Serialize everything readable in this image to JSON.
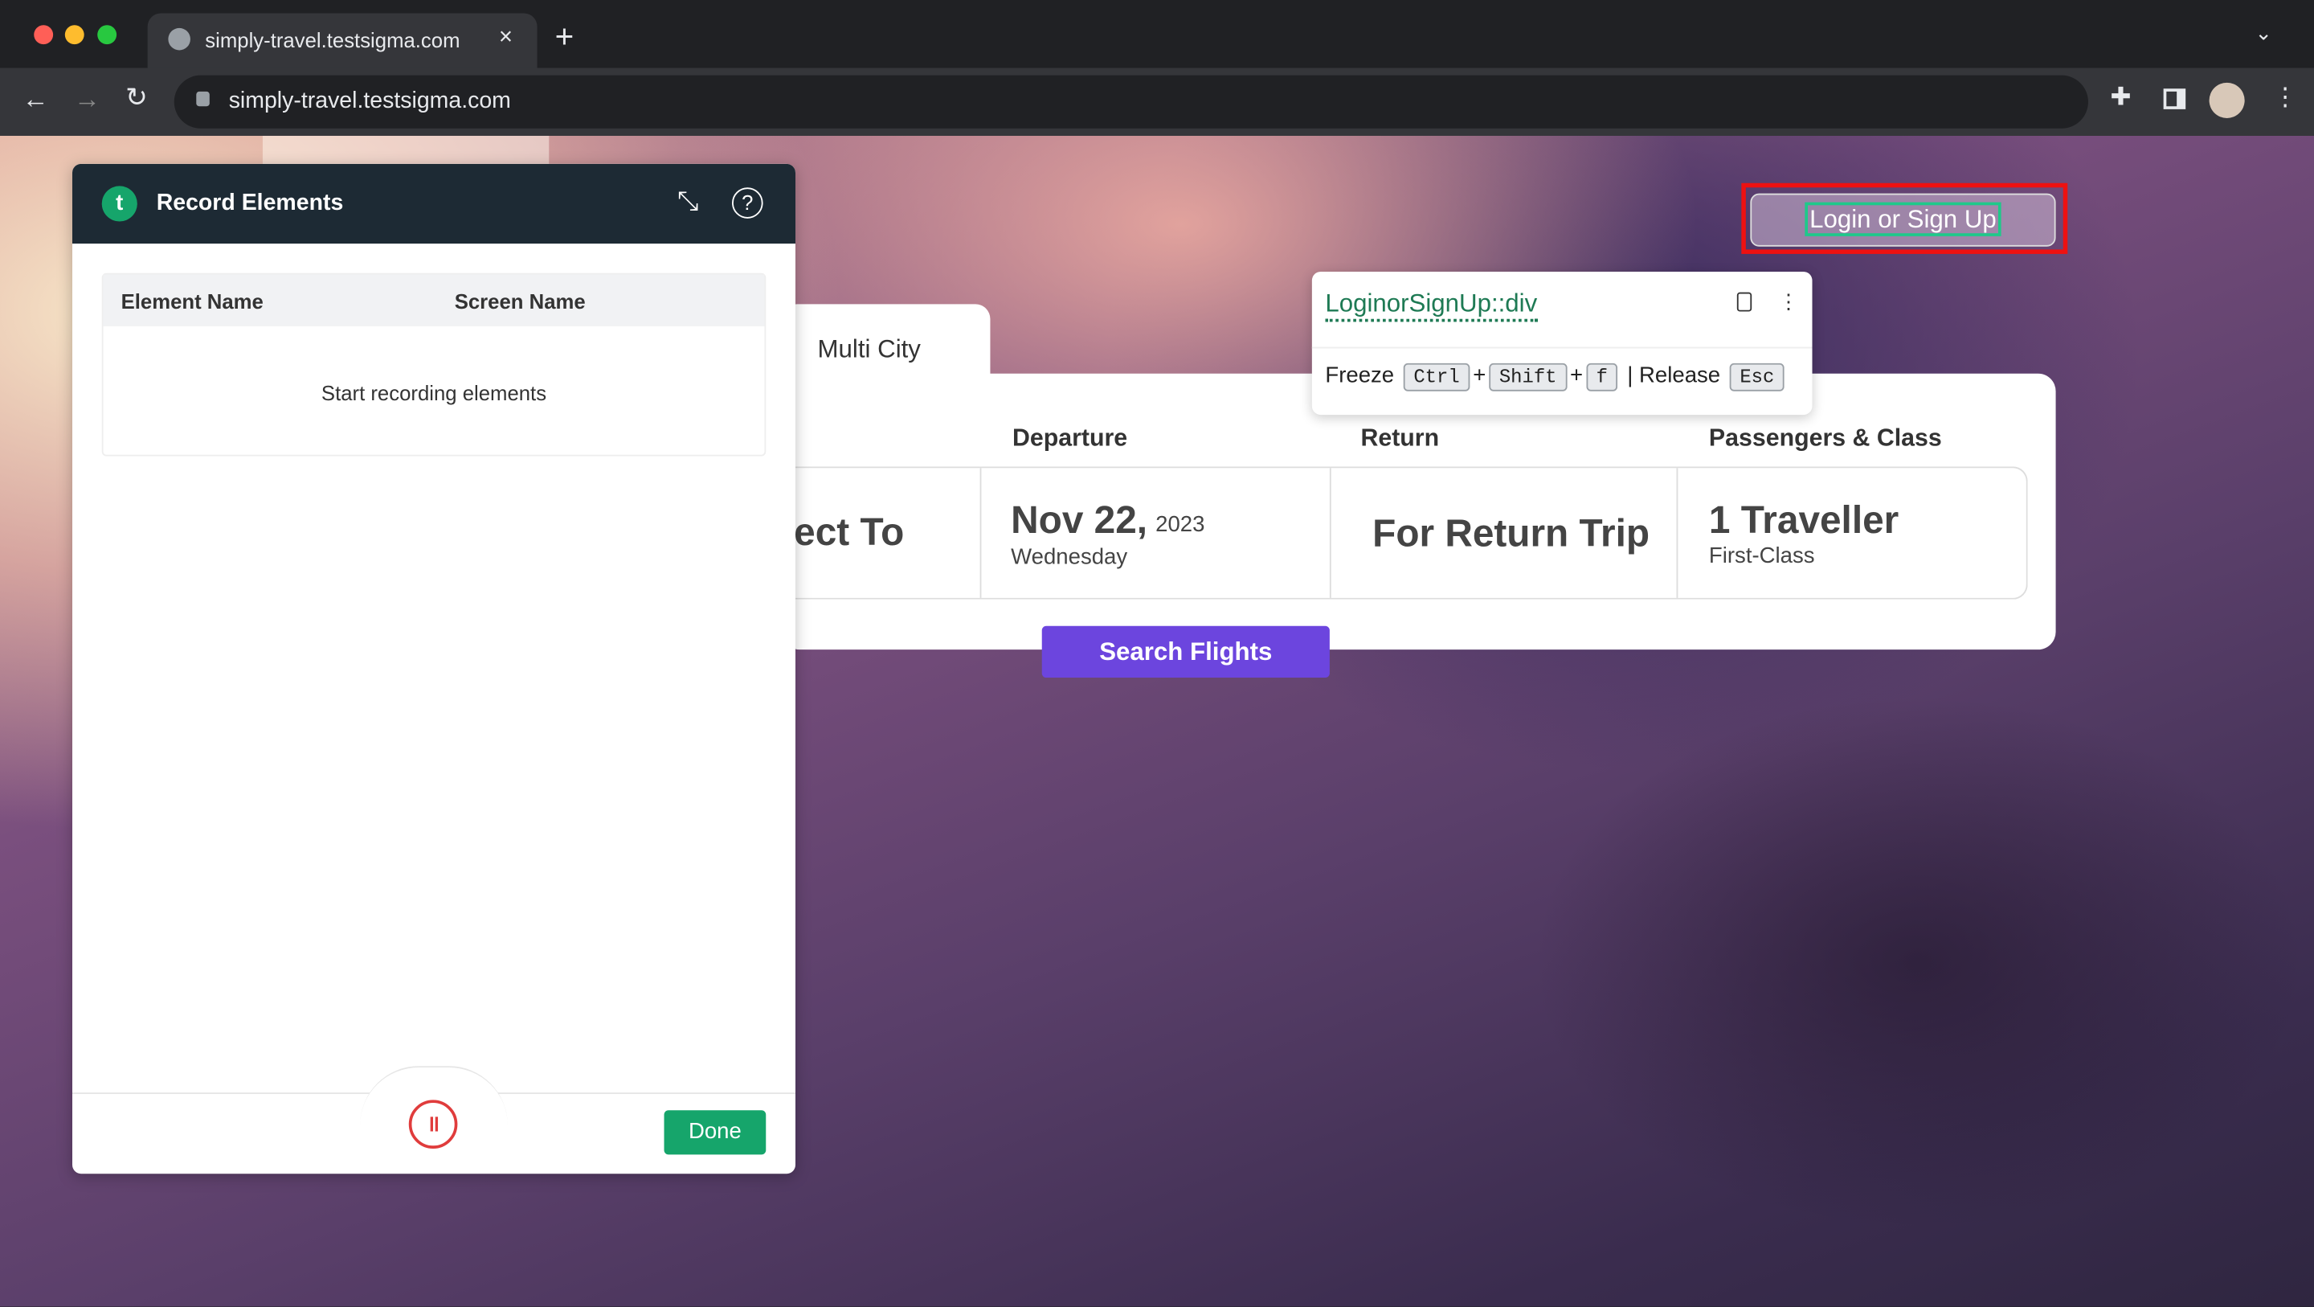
{
  "browser": {
    "tab_title": "simply-travel.testsigma.com",
    "url": "simply-travel.testsigma.com",
    "icons": [
      "globe-icon",
      "close-icon",
      "new-tab-icon",
      "back-icon",
      "forward-icon",
      "reload-icon",
      "lock-icon",
      "share-icon",
      "star-icon",
      "extensions-icon",
      "sidebar-icon",
      "profile-avatar",
      "menu-icon",
      "tab-list-chevron-icon"
    ]
  },
  "recorder": {
    "title": "Record Elements",
    "columns": [
      "Element Name",
      "Screen Name"
    ],
    "empty_text": "Start recording elements",
    "done_label": "Done",
    "accent": "#16a56b"
  },
  "site": {
    "login_label": "Login or Sign Up",
    "trip_tab": "Multi City",
    "labels": {
      "departure": "Departure",
      "return": "Return",
      "passengers": "Passengers & Class"
    },
    "to_partial": "ect To",
    "departure_date": "Nov 22,",
    "departure_year": "2023",
    "departure_day": "Wednesday",
    "return_value": "For Return Trip",
    "travellers": "1 Traveller",
    "class": "First-Class",
    "search_label": "Search Flights",
    "search_color": "#6c45de"
  },
  "tooltip": {
    "locator": "LoginorSignUp::div",
    "freeze": "Freeze",
    "ctrl": "Ctrl",
    "plus": "+",
    "shift": "Shift",
    "f": "f",
    "sep": "|",
    "release": "Release",
    "esc": "Esc"
  }
}
